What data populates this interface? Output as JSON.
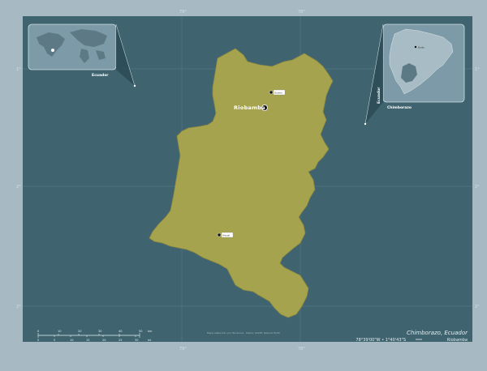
{
  "main_map": {
    "region_name": "Chimborazo",
    "capital_label": "Riobamba",
    "secondary_city_label_1": "Guano",
    "secondary_city_label_2": "Alausí",
    "fill_color": "#a6a34e",
    "ocean_color": "#3f6470",
    "frame_color": "#a7b9c3"
  },
  "top_ticks": [
    "79°",
    "78°"
  ],
  "bottom_ticks": [
    "79°",
    "78°"
  ],
  "left_ticks": [
    "1°",
    "2°",
    "2°"
  ],
  "right_ticks": [
    "1°",
    "2°",
    "2°"
  ],
  "inset_world": {
    "label": "Ecuador",
    "icon": "world-locator-icon"
  },
  "inset_country": {
    "country_label": "Ecuador",
    "region_label": "Chimborazo",
    "capital_label": "Quito"
  },
  "title": "Chimborazo, Ecuador",
  "coords": "78°39'00\"W  •  1°40'43\"S",
  "legend_capital": "Riobamba",
  "scale_bar": {
    "top_labels": [
      "0",
      "10",
      "20",
      "30",
      "40",
      "50"
    ],
    "bottom_labels": [
      "0",
      "5",
      "10",
      "15",
      "20",
      "25",
      "30"
    ],
    "unit_top": "km",
    "unit_bottom": "mi"
  },
  "credits": "Mapa elaborado por TerraLens · Datos: GADM, Natural Earth"
}
